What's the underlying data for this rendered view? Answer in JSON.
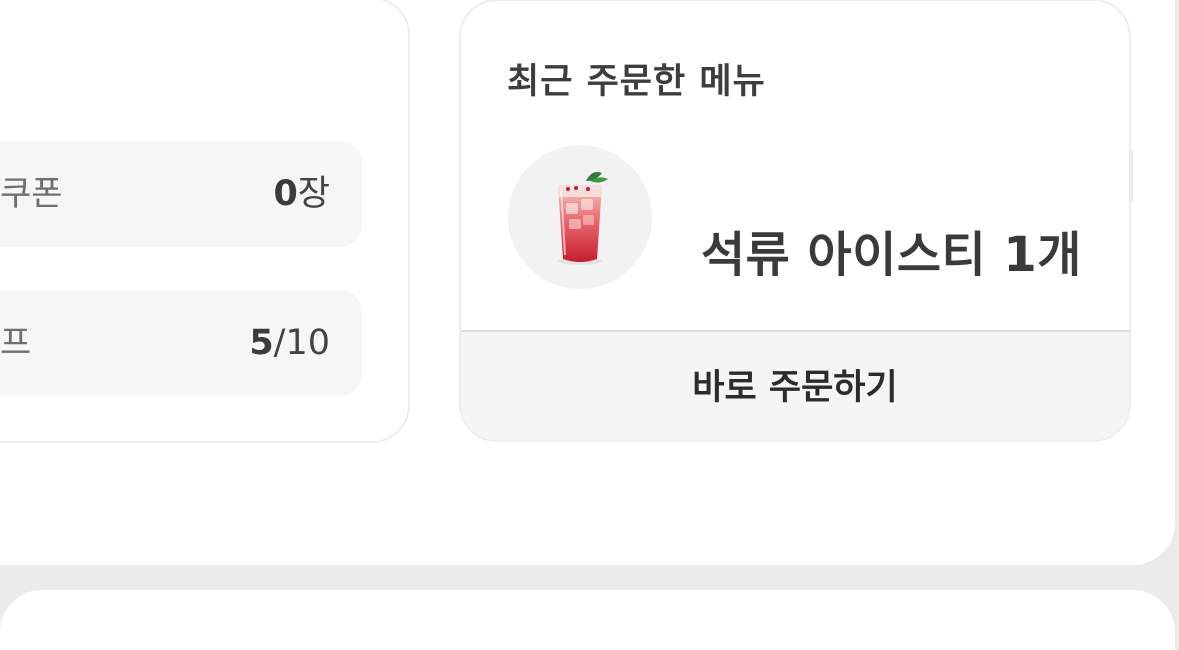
{
  "benefits": {
    "coupon": {
      "label": "쿠폰",
      "value": "0",
      "unit": "장"
    },
    "stamp": {
      "label": "프",
      "current": "5",
      "total": "/10"
    }
  },
  "recent_order": {
    "title": "최근 주문한 메뉴",
    "item_name": "석류 아이스티 1개",
    "item_icon": "pomegranate-iced-tea-image",
    "order_button_label": "바로 주문하기"
  },
  "colors": {
    "background": "#ebebeb",
    "card": "#ffffff",
    "row": "#f6f6f6",
    "button": "#f5f5f5",
    "drink_red": "#d8283a"
  }
}
